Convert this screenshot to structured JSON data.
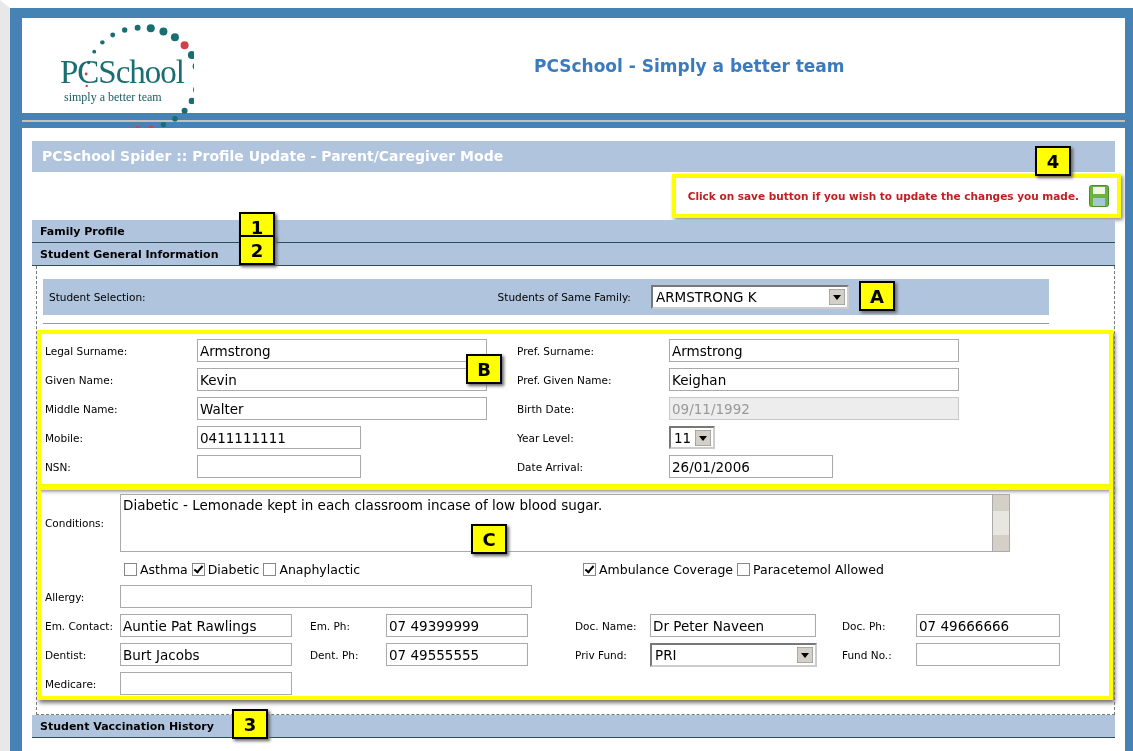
{
  "header": {
    "logo_name": "PCSchool",
    "logo_tagline": "simply a better team",
    "title": "PCSchool - Simply a better team"
  },
  "page_title": "PCSchool Spider :: Profile Update - Parent/Caregiver Mode",
  "save_note": {
    "text": "Click on save button if you wish to update the changes you made.",
    "callout": "4"
  },
  "sections": [
    {
      "title": "Family Profile",
      "callout": "1"
    },
    {
      "title": "Student General Information",
      "callout": "2"
    }
  ],
  "student_selection": {
    "label": "Student Selection:",
    "family_label": "Students of Same Family:",
    "family_value": "ARMSTRONG K",
    "callout": "A"
  },
  "general": {
    "callout": "B",
    "left": [
      {
        "label": "Legal Surname:",
        "value": "Armstrong",
        "kind": "long",
        "disabled": false
      },
      {
        "label": "Given Name:",
        "value": "Kevin",
        "kind": "long",
        "disabled": false
      },
      {
        "label": "Middle Name:",
        "value": "Walter",
        "kind": "long",
        "disabled": false
      },
      {
        "label": "Mobile:",
        "value": "0411111111",
        "kind": "short",
        "disabled": false
      },
      {
        "label": "NSN:",
        "kind": "short",
        "disabled": false
      }
    ],
    "right": [
      {
        "label": "Pref. Surname:",
        "value": "Armstrong",
        "kind": "long",
        "disabled": false
      },
      {
        "label": "Pref. Given Name:",
        "value": "Keighan",
        "kind": "long",
        "disabled": false
      },
      {
        "label": "Birth Date:",
        "value": "09/11/1992",
        "kind": "long",
        "disabled": true
      },
      {
        "label": "Year Level:",
        "value": "11",
        "kind": "select",
        "disabled": false
      },
      {
        "label": "Date Arrival:",
        "value": "26/01/2006",
        "kind": "short",
        "disabled": false
      }
    ]
  },
  "medical": {
    "callout": "C",
    "conditions_label": "Conditions:",
    "conditions": "Diabetic - Lemonade kept in each classroom incase of low blood sugar.",
    "checks_left": [
      {
        "label": "Asthma",
        "checked": false
      },
      {
        "label": "Diabetic",
        "checked": true
      },
      {
        "label": "Anaphylactic",
        "checked": false
      }
    ],
    "checks_right": [
      {
        "label": "Ambulance Coverage",
        "checked": true
      },
      {
        "label": "Paracetemol Allowed",
        "checked": false
      }
    ],
    "allergy_label": "Allergy:",
    "rows": [
      [
        {
          "label": "Em. Contact:",
          "value": "Auntie Pat Rawlings",
          "kind": "text"
        },
        {
          "label": "Em. Ph:",
          "value": "07 49399999",
          "kind": "text"
        },
        {
          "label": "Doc. Name:",
          "value": "Dr Peter Naveen",
          "kind": "text"
        },
        {
          "label": "Doc. Ph:",
          "value": "07 49666666",
          "kind": "text"
        }
      ],
      [
        {
          "label": "Dentist:",
          "value": "Burt Jacobs",
          "kind": "text"
        },
        {
          "label": "Dent. Ph:",
          "value": "07 49555555",
          "kind": "text"
        },
        {
          "label": "Priv Fund:",
          "value": "PRI",
          "kind": "select"
        },
        {
          "label": "Fund No.:",
          "kind": "text"
        }
      ],
      [
        {
          "label": "Medicare:",
          "kind": "text"
        }
      ]
    ]
  },
  "vaccination": {
    "title": "Student Vaccination History",
    "callout": "3"
  }
}
